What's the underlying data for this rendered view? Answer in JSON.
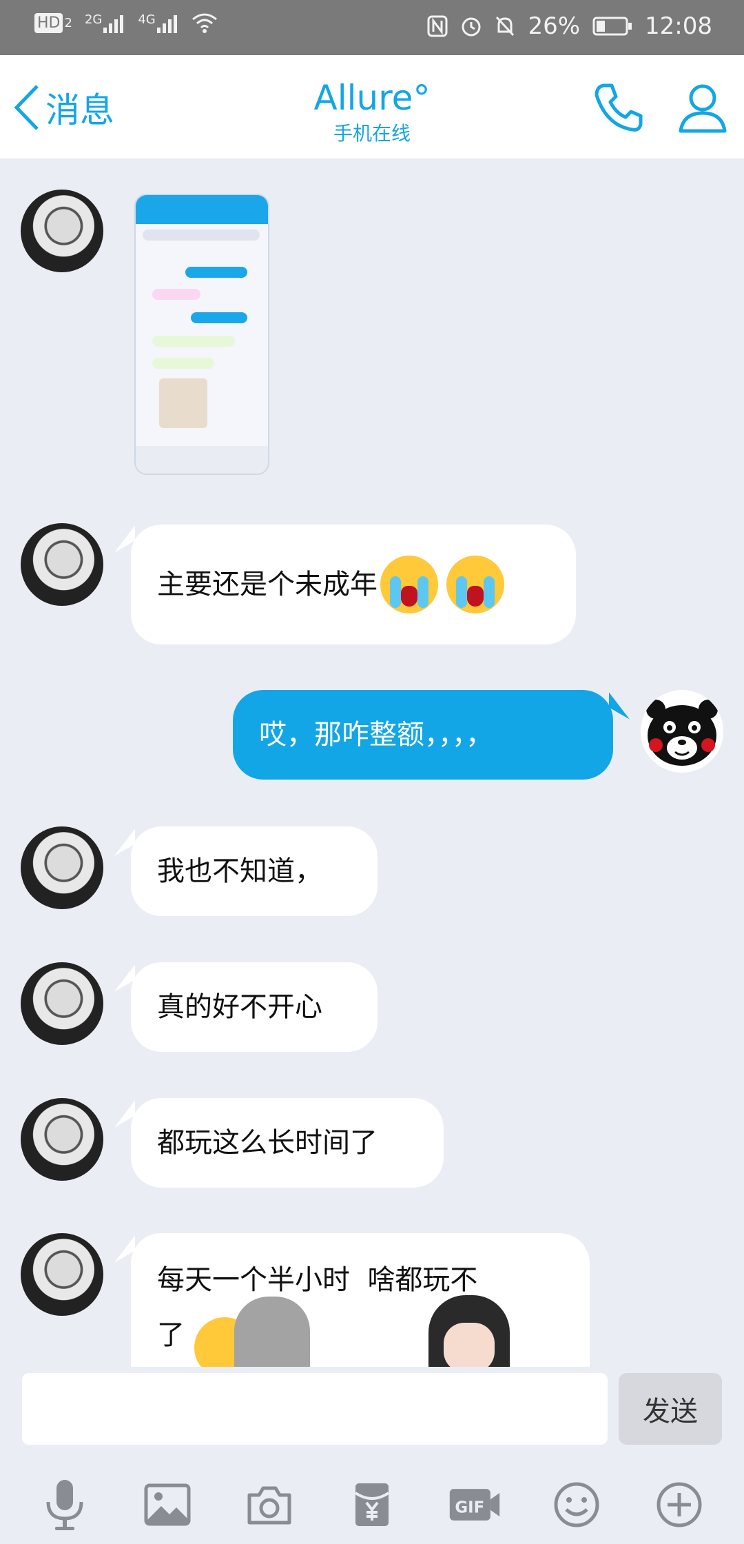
{
  "status_bar": {
    "left_labels": [
      "HD",
      "2",
      "2G",
      "4G"
    ],
    "battery": "26%",
    "time": "12:08"
  },
  "nav": {
    "back_label": "消息",
    "title": "Allure°",
    "subtitle": "手机在线"
  },
  "messages": [
    {
      "sender": "contact",
      "type": "image"
    },
    {
      "sender": "contact",
      "type": "text",
      "text": "主要还是个未成年",
      "emoji": [
        "crying-emoji",
        "crying-emoji"
      ]
    },
    {
      "sender": "me",
      "type": "text",
      "text": "哎，那咋整额，，，，"
    },
    {
      "sender": "contact",
      "type": "text",
      "text": "我也不知道，"
    },
    {
      "sender": "contact",
      "type": "text",
      "text": "真的好不开心"
    },
    {
      "sender": "contact",
      "type": "text",
      "text": "都玩这么长时间了"
    },
    {
      "sender": "contact",
      "type": "text",
      "text": "每天一个半小时  啥都玩不",
      "text_line2": "了"
    }
  ],
  "input": {
    "value": "",
    "placeholder": "",
    "send_label": "发送"
  },
  "toolbar_icons": [
    "microphone-icon",
    "image-icon",
    "camera-icon",
    "red-packet-icon",
    "gif-icon",
    "emoji-icon",
    "plus-icon"
  ],
  "colors": {
    "accent": "#12a6e6",
    "background": "#ebedf5",
    "outgoing_bubble": "#12a6e6",
    "incoming_bubble": "#ffffff"
  }
}
